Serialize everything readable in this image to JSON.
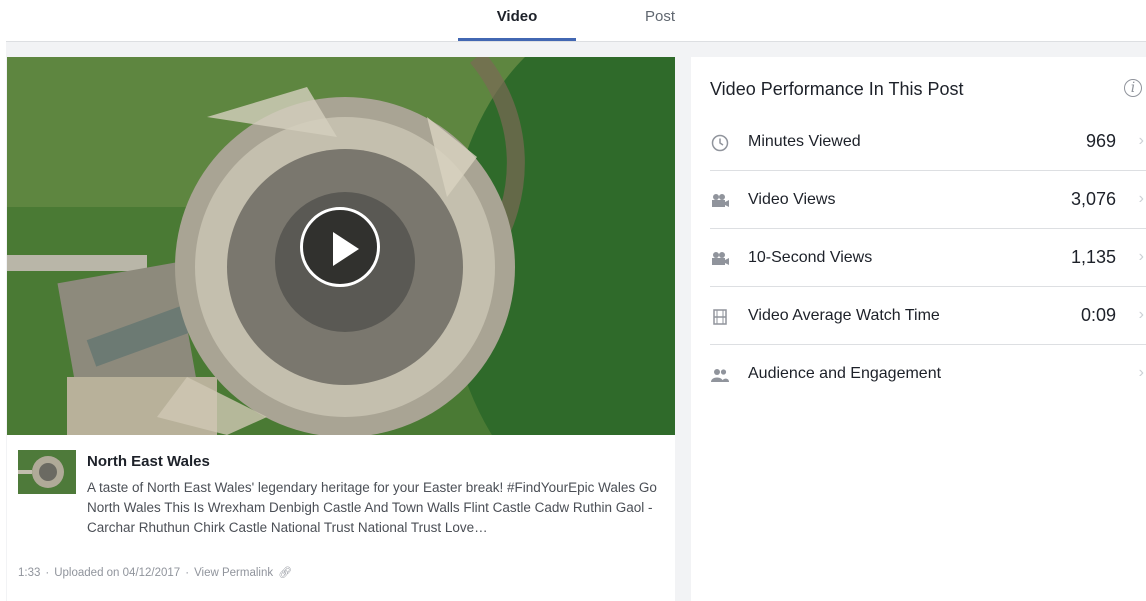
{
  "tabs": [
    {
      "label": "Video",
      "active": true
    },
    {
      "label": "Post",
      "active": false
    }
  ],
  "video": {
    "post_title": "North East Wales",
    "description": "A taste of North East Wales' legendary heritage for your Easter break! #FindYourEpic Wales Go North Wales This Is Wrexham Denbigh Castle And Town Walls Flint Castle Cadw Ruthin Gaol - Carchar Rhuthun Chirk Castle National Trust National Trust Love…",
    "duration": "1:33",
    "uploaded": "Uploaded on 04/12/2017",
    "permalink_label": "View Permalink",
    "separator": "·"
  },
  "performance": {
    "title": "Video Performance In This Post",
    "info_icon": "i",
    "metrics": [
      {
        "label": "Minutes Viewed",
        "value": "969",
        "icon": "clock-icon"
      },
      {
        "label": "Video Views",
        "value": "3,076",
        "icon": "camera-icon"
      },
      {
        "label": "10-Second Views",
        "value": "1,135",
        "icon": "camera-icon"
      },
      {
        "label": "Video Average Watch Time",
        "value": "0:09",
        "icon": "film-icon"
      },
      {
        "label": "Audience and Engagement",
        "value": "",
        "icon": "people-icon"
      }
    ],
    "chevron": "›"
  },
  "colors": {
    "accent": "#4267b2",
    "background": "#f2f3f5",
    "text": "#1d2129",
    "muted": "#90949c"
  }
}
